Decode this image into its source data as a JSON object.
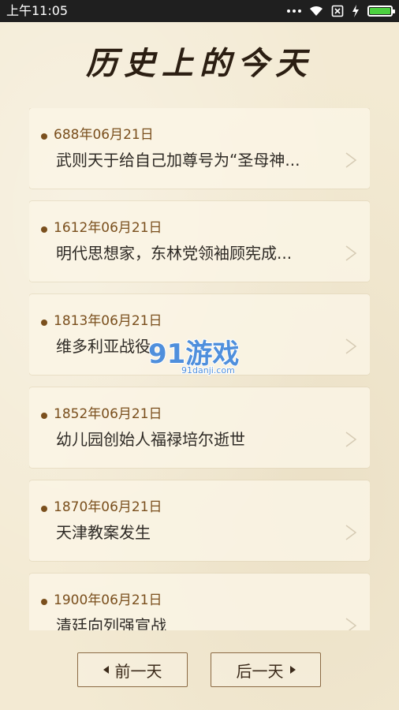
{
  "status_bar": {
    "time": "上午11:05",
    "icons": [
      "more-dots-icon",
      "wifi-icon",
      "sim-blocked-icon",
      "charging-bolt-icon",
      "battery-icon"
    ],
    "battery_color": "#4cd13f"
  },
  "header": {
    "title": "历史上的今天"
  },
  "events": [
    {
      "date": "688年06月21日",
      "title": "武则天于给自己加尊号为“圣母神..."
    },
    {
      "date": "1612年06月21日",
      "title": "明代思想家，东林党领袖顾宪成..."
    },
    {
      "date": "1813年06月21日",
      "title": "维多利亚战役"
    },
    {
      "date": "1852年06月21日",
      "title": "幼儿园创始人福禄培尔逝世"
    },
    {
      "date": "1870年06月21日",
      "title": "天津教案发生"
    },
    {
      "date": "1900年06月21日",
      "title": "清廷向列强宣战"
    }
  ],
  "watermark": {
    "logo_text": "91游戏",
    "url_text": "91danji.com"
  },
  "nav": {
    "prev_label": "前一天",
    "next_label": "后一天"
  },
  "colors": {
    "accent": "#7a4f1d",
    "text": "#2e2a25",
    "background": "#f3ead3",
    "watermark": "#4f8fdc"
  }
}
